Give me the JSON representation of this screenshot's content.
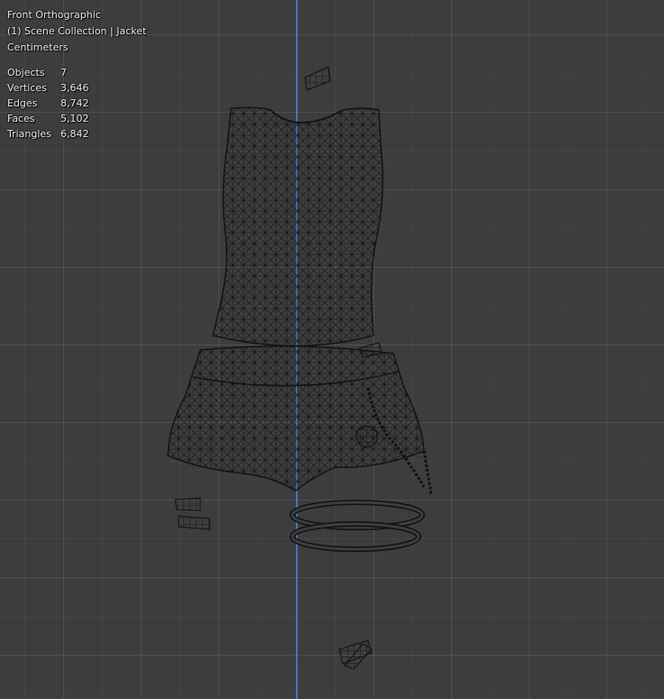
{
  "viewport": {
    "view_name": "Front Orthographic",
    "collection": "(1) Scene Collection | Jacket",
    "units": "Centimeters",
    "stats": [
      {
        "label": "Objects",
        "value": "7"
      },
      {
        "label": "Vertices",
        "value": "3,646"
      },
      {
        "label": "Edges",
        "value": "8,742"
      },
      {
        "label": "Faces",
        "value": "5,102"
      },
      {
        "label": "Triangles",
        "value": "6,842"
      }
    ]
  },
  "colors": {
    "background": "#3d3d3d",
    "z_axis": "#4872b8",
    "wire": "#111111",
    "text": "#e8e8e8"
  }
}
